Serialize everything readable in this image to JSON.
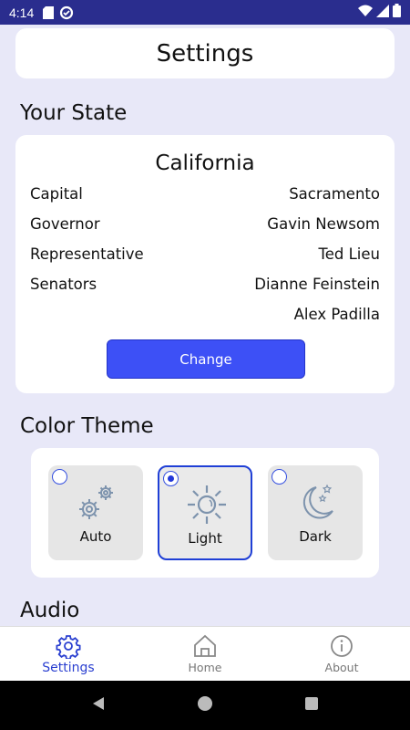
{
  "status_bar": {
    "time": "4:14"
  },
  "header": {
    "title": "Settings"
  },
  "your_state": {
    "heading": "Your State",
    "state_name": "California",
    "rows": [
      {
        "label": "Capital",
        "value": "Sacramento"
      },
      {
        "label": "Governor",
        "value": "Gavin Newsom"
      },
      {
        "label": "Representative",
        "value": "Ted Lieu"
      },
      {
        "label": "Senators",
        "value": "Dianne Feinstein"
      },
      {
        "label": "",
        "value": "Alex Padilla"
      }
    ],
    "change_label": "Change"
  },
  "color_theme": {
    "heading": "Color Theme",
    "options": [
      {
        "label": "Auto",
        "icon": "gears-icon",
        "selected": false
      },
      {
        "label": "Light",
        "icon": "sun-icon",
        "selected": true
      },
      {
        "label": "Dark",
        "icon": "moon-stars-icon",
        "selected": false
      }
    ],
    "accent": "#2338d8"
  },
  "audio": {
    "heading": "Audio"
  },
  "bottom_nav": {
    "items": [
      {
        "label": "Settings",
        "icon": "gear-icon",
        "active": true
      },
      {
        "label": "Home",
        "icon": "home-icon",
        "active": false
      },
      {
        "label": "About",
        "icon": "info-icon",
        "active": false
      }
    ]
  },
  "colors": {
    "status_bar": "#2a2d8e",
    "background": "#e8e8f8",
    "primary_button": "#3d50f6"
  }
}
